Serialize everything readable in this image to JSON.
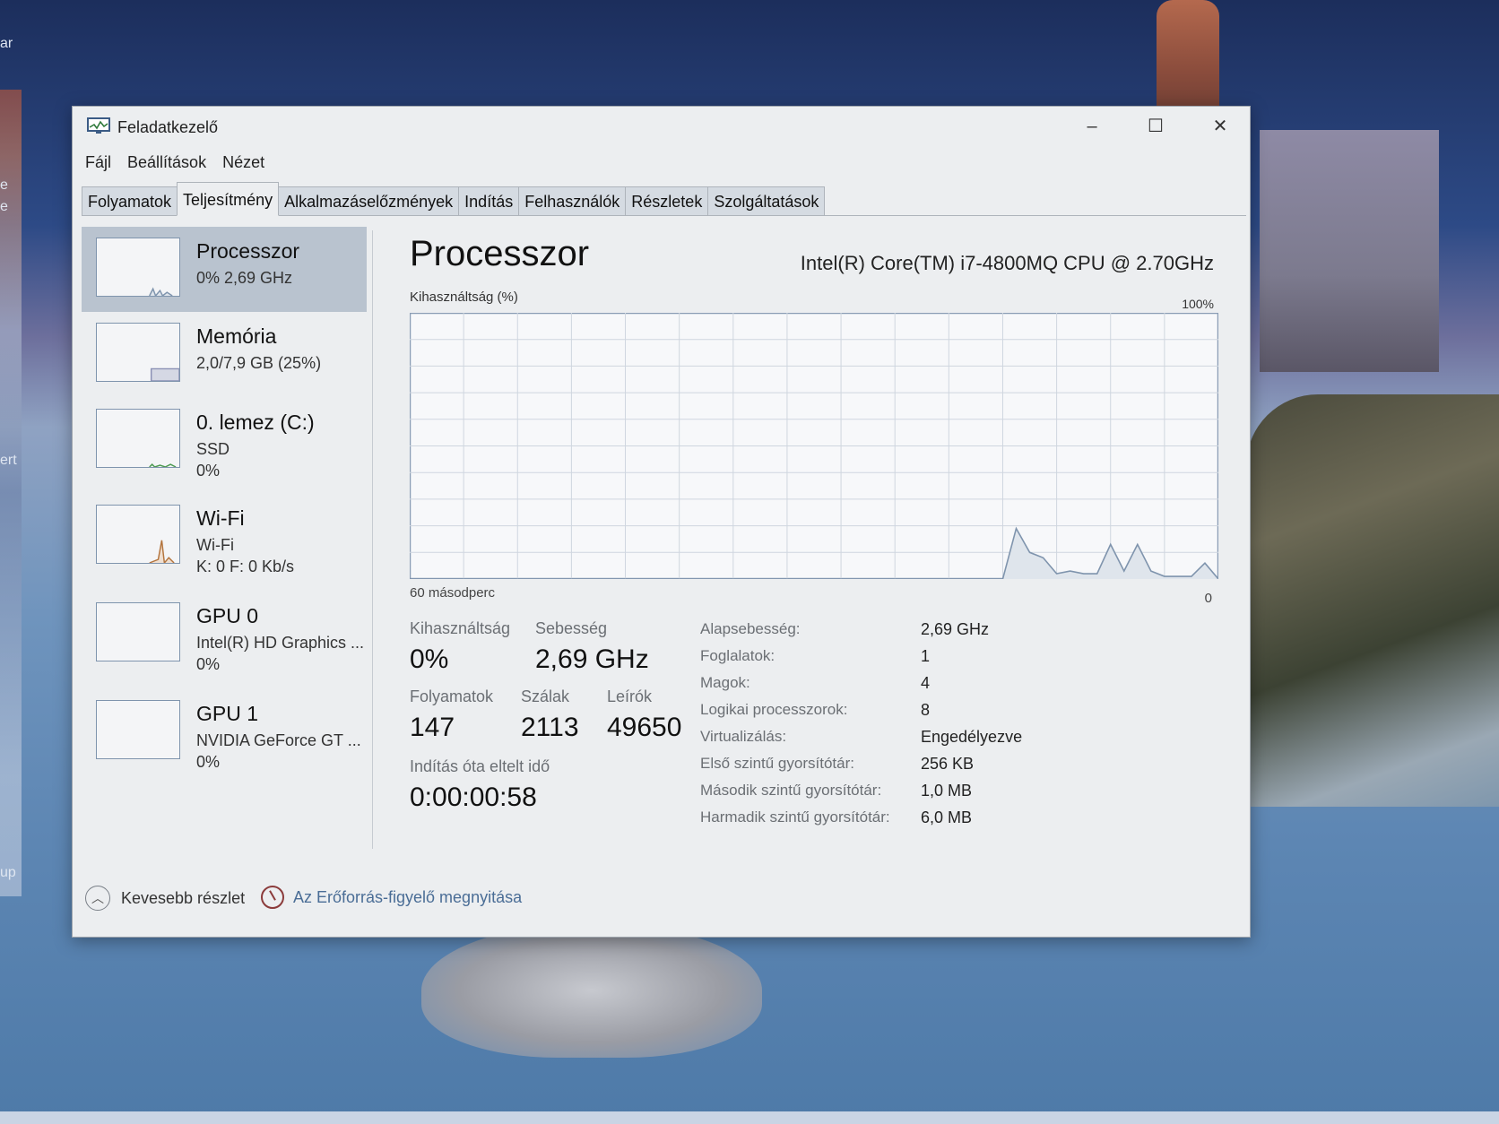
{
  "window": {
    "title": "Feladatkezelő",
    "controls": {
      "minimize": "–",
      "maximize": "☐",
      "close": "✕"
    }
  },
  "menu": [
    "Fájl",
    "Beállítások",
    "Nézet"
  ],
  "tabs": [
    "Folyamatok",
    "Teljesítmény",
    "Alkalmazáselőzmények",
    "Indítás",
    "Felhasználók",
    "Részletek",
    "Szolgáltatások"
  ],
  "active_tab": "Teljesítmény",
  "sidebar": [
    {
      "name": "Processzor",
      "line1": "0% 2,69 GHz",
      "line2": ""
    },
    {
      "name": "Memória",
      "line1": "2,0/7,9 GB (25%)",
      "line2": ""
    },
    {
      "name": "0. lemez (C:)",
      "line1": "SSD",
      "line2": "0%"
    },
    {
      "name": "Wi-Fi",
      "line1": "Wi-Fi",
      "line2": "K: 0 F: 0 Kb/s"
    },
    {
      "name": "GPU 0",
      "line1": "Intel(R) HD Graphics ...",
      "line2": "0%"
    },
    {
      "name": "GPU 1",
      "line1": "NVIDIA GeForce GT ...",
      "line2": "0%"
    }
  ],
  "main": {
    "title": "Processzor",
    "cpu_name": "Intel(R) Core(TM) i7-4800MQ CPU @ 2.70GHz",
    "util_label": "Kihasználtság (%)",
    "max_label": "100%",
    "time_label": "60 másodperc",
    "zero_label": "0",
    "stats": {
      "util_label": "Kihasználtság",
      "util_value": "0%",
      "speed_label": "Sebesség",
      "speed_value": "2,69 GHz",
      "proc_label": "Folyamatok",
      "proc_value": "147",
      "threads_label": "Szálak",
      "threads_value": "2113",
      "handles_label": "Leírók",
      "handles_value": "49650",
      "uptime_label": "Indítás óta eltelt idő",
      "uptime_value": "0:00:00:58"
    },
    "details": [
      {
        "key": "Alapsebesség:",
        "value": "2,69 GHz"
      },
      {
        "key": "Foglalatok:",
        "value": "1"
      },
      {
        "key": "Magok:",
        "value": "4"
      },
      {
        "key": "Logikai processzorok:",
        "value": "8"
      },
      {
        "key": "Virtualizálás:",
        "value": "Engedélyezve"
      },
      {
        "key": "Első szintű gyorsítótár:",
        "value": "256 KB"
      },
      {
        "key": "Második szintű gyorsítótár:",
        "value": "1,0 MB"
      },
      {
        "key": "Harmadik szintű gyorsítótár:",
        "value": "6,0 MB"
      }
    ]
  },
  "footer": {
    "fewer_details": "Kevesebb részlet",
    "resource_monitor": "Az Erőforrás-figyelő megnyitása"
  },
  "desktop": {
    "left_texts": [
      "ar",
      "e",
      "e",
      "ert",
      "up"
    ]
  },
  "colors": {
    "graph_line": "#7f94ad",
    "graph_fill": "#dfe5ec",
    "active_side": "#b9c3cf",
    "link": "#4a6d96"
  },
  "chart_data": {
    "type": "area",
    "x_range_seconds": 60,
    "ylim": [
      0,
      100
    ],
    "series": [
      {
        "name": "Kihasználtság (%)",
        "values": [
          0,
          0,
          0,
          0,
          0,
          0,
          0,
          0,
          0,
          0,
          0,
          0,
          0,
          0,
          0,
          0,
          0,
          0,
          0,
          0,
          0,
          0,
          0,
          0,
          0,
          0,
          0,
          0,
          0,
          0,
          0,
          0,
          0,
          0,
          0,
          0,
          0,
          0,
          0,
          0,
          0,
          0,
          0,
          0,
          0,
          19,
          10,
          8,
          2,
          3,
          2,
          2,
          13,
          3,
          13,
          3,
          1,
          1,
          1,
          6,
          0
        ]
      }
    ]
  }
}
